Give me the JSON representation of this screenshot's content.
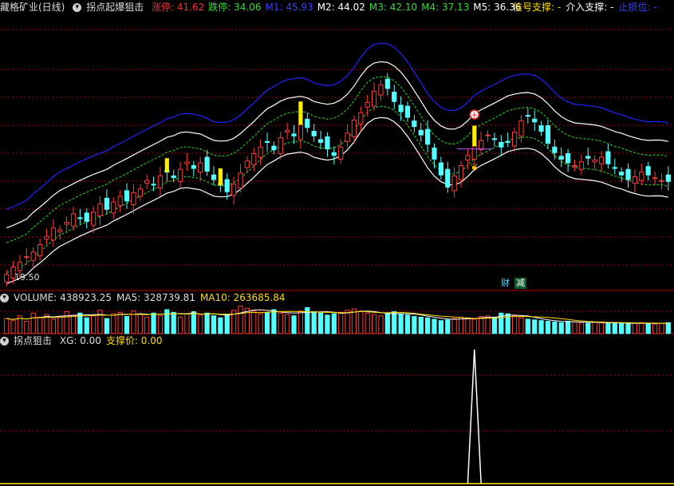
{
  "header": {
    "stock_name": "藏格矿业(日线)",
    "indicator_name": "拐点起爆狙击",
    "items": [
      {
        "label": "涨停:",
        "value": "41.62",
        "color": "#ff3030"
      },
      {
        "label": "跌停:",
        "value": "34.06",
        "color": "#33dd33"
      },
      {
        "label": "M1:",
        "value": "45.93",
        "color": "#3344ff"
      },
      {
        "label": "M2:",
        "value": "44.02",
        "color": "#ffffff"
      },
      {
        "label": "M3:",
        "value": "42.10",
        "color": "#33dd33"
      },
      {
        "label": "M4:",
        "value": "37.13",
        "color": "#33dd33"
      },
      {
        "label": "M5:",
        "value": "36.36",
        "color": "#ffffff"
      }
    ],
    "right_items": [
      {
        "label": "信号支撑:",
        "value": "-",
        "color": "#ffdd00"
      },
      {
        "label": "介入支撑:",
        "value": "-",
        "color": "#ffffff"
      },
      {
        "label": "止损位:",
        "value": "-",
        "color": "#3344ff"
      }
    ]
  },
  "price_axis_label": "19.50",
  "badges": {
    "cai": "财",
    "jian": "减"
  },
  "volume_panel": {
    "title": "VOLUME",
    "items": [
      {
        "label": "VOLUME:",
        "value": "438923.25",
        "color": "#dddddd"
      },
      {
        "label": "MA5:",
        "value": "328739.81",
        "color": "#dddddd"
      },
      {
        "label": "MA10:",
        "value": "263685.84",
        "color": "#ffdd00"
      }
    ]
  },
  "indicator_panel": {
    "name": "拐点狙击",
    "items": [
      {
        "label": "XG:",
        "value": "0.00",
        "color": "#dddddd"
      },
      {
        "label": "支撑价:",
        "value": "0.00",
        "color": "#ffdd00"
      }
    ]
  },
  "colors": {
    "up": "#ff3b3b",
    "down": "#55ffff",
    "m1": "#2222ff",
    "band": "#ffffff",
    "dash": "#22bb22",
    "signal": "#ffee00",
    "grid": "#aa0000"
  },
  "chart_data": {
    "type": "candlestick",
    "price_ylim": [
      19.5,
      48
    ],
    "close": [
      20.2,
      21.0,
      21.5,
      22.1,
      22.6,
      23.4,
      24.3,
      25.2,
      25.0,
      25.8,
      26.7,
      26.2,
      25.9,
      26.9,
      27.8,
      27.2,
      28.0,
      28.6,
      28.1,
      29.0,
      29.4,
      30.3,
      29.9,
      30.8,
      31.2,
      30.6,
      31.5,
      32.3,
      31.6,
      32.2,
      31.3,
      30.4,
      29.8,
      29.1,
      29.9,
      31.1,
      32.4,
      33.2,
      33.9,
      34.4,
      33.6,
      34.9,
      35.7,
      35.1,
      36.3,
      36.0,
      35.1,
      34.4,
      33.7,
      33.0,
      33.9,
      35.4,
      36.8,
      37.6,
      38.7,
      39.9,
      40.6,
      40.2,
      38.8,
      37.7,
      37.1,
      36.1,
      35.2,
      34.2,
      32.6,
      30.9,
      29.6,
      30.8,
      31.9,
      33.0,
      34.0,
      34.6,
      35.2,
      34.8,
      33.9,
      34.4,
      35.5,
      36.7,
      37.3,
      36.6,
      35.6,
      34.3,
      33.3,
      32.6,
      32.2,
      31.9,
      32.3,
      32.7,
      32.5,
      32.8,
      32.1,
      31.6,
      30.9,
      30.4,
      30.7,
      31.2,
      30.9,
      30.6,
      30.3,
      30.2
    ],
    "volume": [
      220000,
      190000,
      260000,
      180000,
      300000,
      240000,
      280000,
      210000,
      250000,
      320000,
      270000,
      300000,
      230000,
      260000,
      340000,
      220000,
      290000,
      310000,
      250000,
      330000,
      280000,
      240000,
      300000,
      260000,
      350000,
      310000,
      240000,
      290000,
      320000,
      270000,
      300000,
      260000,
      230000,
      280000,
      340000,
      400000,
      370000,
      330000,
      290000,
      310000,
      350000,
      300000,
      280000,
      260000,
      330000,
      380000,
      320000,
      300000,
      270000,
      290000,
      310000,
      340000,
      360000,
      330000,
      300000,
      280000,
      260000,
      300000,
      320000,
      290000,
      270000,
      250000,
      240000,
      230000,
      210000,
      190000,
      200000,
      220000,
      240000,
      230000,
      210000,
      250000,
      260000,
      240000,
      300000,
      290000,
      260000,
      230000,
      210000,
      200000,
      190000,
      180000,
      170000,
      160000,
      180000,
      170000,
      160000,
      150000,
      170000,
      160000,
      150000,
      160000,
      150000,
      140000,
      150000,
      160000,
      150000,
      140000,
      150000,
      160000
    ],
    "xg_spike_index": 70,
    "xg_ylim": [
      0,
      1
    ]
  }
}
